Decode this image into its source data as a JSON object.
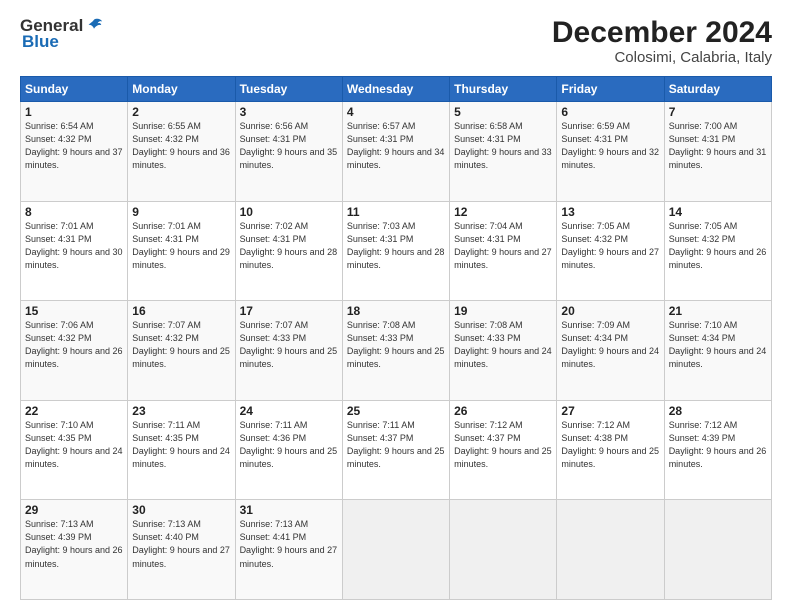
{
  "logo": {
    "general": "General",
    "blue": "Blue"
  },
  "header": {
    "month": "December 2024",
    "location": "Colosimi, Calabria, Italy"
  },
  "weekdays": [
    "Sunday",
    "Monday",
    "Tuesday",
    "Wednesday",
    "Thursday",
    "Friday",
    "Saturday"
  ],
  "weeks": [
    [
      {
        "day": "1",
        "sunrise": "Sunrise: 6:54 AM",
        "sunset": "Sunset: 4:32 PM",
        "daylight": "Daylight: 9 hours and 37 minutes."
      },
      {
        "day": "2",
        "sunrise": "Sunrise: 6:55 AM",
        "sunset": "Sunset: 4:32 PM",
        "daylight": "Daylight: 9 hours and 36 minutes."
      },
      {
        "day": "3",
        "sunrise": "Sunrise: 6:56 AM",
        "sunset": "Sunset: 4:31 PM",
        "daylight": "Daylight: 9 hours and 35 minutes."
      },
      {
        "day": "4",
        "sunrise": "Sunrise: 6:57 AM",
        "sunset": "Sunset: 4:31 PM",
        "daylight": "Daylight: 9 hours and 34 minutes."
      },
      {
        "day": "5",
        "sunrise": "Sunrise: 6:58 AM",
        "sunset": "Sunset: 4:31 PM",
        "daylight": "Daylight: 9 hours and 33 minutes."
      },
      {
        "day": "6",
        "sunrise": "Sunrise: 6:59 AM",
        "sunset": "Sunset: 4:31 PM",
        "daylight": "Daylight: 9 hours and 32 minutes."
      },
      {
        "day": "7",
        "sunrise": "Sunrise: 7:00 AM",
        "sunset": "Sunset: 4:31 PM",
        "daylight": "Daylight: 9 hours and 31 minutes."
      }
    ],
    [
      {
        "day": "8",
        "sunrise": "Sunrise: 7:01 AM",
        "sunset": "Sunset: 4:31 PM",
        "daylight": "Daylight: 9 hours and 30 minutes."
      },
      {
        "day": "9",
        "sunrise": "Sunrise: 7:01 AM",
        "sunset": "Sunset: 4:31 PM",
        "daylight": "Daylight: 9 hours and 29 minutes."
      },
      {
        "day": "10",
        "sunrise": "Sunrise: 7:02 AM",
        "sunset": "Sunset: 4:31 PM",
        "daylight": "Daylight: 9 hours and 28 minutes."
      },
      {
        "day": "11",
        "sunrise": "Sunrise: 7:03 AM",
        "sunset": "Sunset: 4:31 PM",
        "daylight": "Daylight: 9 hours and 28 minutes."
      },
      {
        "day": "12",
        "sunrise": "Sunrise: 7:04 AM",
        "sunset": "Sunset: 4:31 PM",
        "daylight": "Daylight: 9 hours and 27 minutes."
      },
      {
        "day": "13",
        "sunrise": "Sunrise: 7:05 AM",
        "sunset": "Sunset: 4:32 PM",
        "daylight": "Daylight: 9 hours and 27 minutes."
      },
      {
        "day": "14",
        "sunrise": "Sunrise: 7:05 AM",
        "sunset": "Sunset: 4:32 PM",
        "daylight": "Daylight: 9 hours and 26 minutes."
      }
    ],
    [
      {
        "day": "15",
        "sunrise": "Sunrise: 7:06 AM",
        "sunset": "Sunset: 4:32 PM",
        "daylight": "Daylight: 9 hours and 26 minutes."
      },
      {
        "day": "16",
        "sunrise": "Sunrise: 7:07 AM",
        "sunset": "Sunset: 4:32 PM",
        "daylight": "Daylight: 9 hours and 25 minutes."
      },
      {
        "day": "17",
        "sunrise": "Sunrise: 7:07 AM",
        "sunset": "Sunset: 4:33 PM",
        "daylight": "Daylight: 9 hours and 25 minutes."
      },
      {
        "day": "18",
        "sunrise": "Sunrise: 7:08 AM",
        "sunset": "Sunset: 4:33 PM",
        "daylight": "Daylight: 9 hours and 25 minutes."
      },
      {
        "day": "19",
        "sunrise": "Sunrise: 7:08 AM",
        "sunset": "Sunset: 4:33 PM",
        "daylight": "Daylight: 9 hours and 24 minutes."
      },
      {
        "day": "20",
        "sunrise": "Sunrise: 7:09 AM",
        "sunset": "Sunset: 4:34 PM",
        "daylight": "Daylight: 9 hours and 24 minutes."
      },
      {
        "day": "21",
        "sunrise": "Sunrise: 7:10 AM",
        "sunset": "Sunset: 4:34 PM",
        "daylight": "Daylight: 9 hours and 24 minutes."
      }
    ],
    [
      {
        "day": "22",
        "sunrise": "Sunrise: 7:10 AM",
        "sunset": "Sunset: 4:35 PM",
        "daylight": "Daylight: 9 hours and 24 minutes."
      },
      {
        "day": "23",
        "sunrise": "Sunrise: 7:11 AM",
        "sunset": "Sunset: 4:35 PM",
        "daylight": "Daylight: 9 hours and 24 minutes."
      },
      {
        "day": "24",
        "sunrise": "Sunrise: 7:11 AM",
        "sunset": "Sunset: 4:36 PM",
        "daylight": "Daylight: 9 hours and 25 minutes."
      },
      {
        "day": "25",
        "sunrise": "Sunrise: 7:11 AM",
        "sunset": "Sunset: 4:37 PM",
        "daylight": "Daylight: 9 hours and 25 minutes."
      },
      {
        "day": "26",
        "sunrise": "Sunrise: 7:12 AM",
        "sunset": "Sunset: 4:37 PM",
        "daylight": "Daylight: 9 hours and 25 minutes."
      },
      {
        "day": "27",
        "sunrise": "Sunrise: 7:12 AM",
        "sunset": "Sunset: 4:38 PM",
        "daylight": "Daylight: 9 hours and 25 minutes."
      },
      {
        "day": "28",
        "sunrise": "Sunrise: 7:12 AM",
        "sunset": "Sunset: 4:39 PM",
        "daylight": "Daylight: 9 hours and 26 minutes."
      }
    ],
    [
      {
        "day": "29",
        "sunrise": "Sunrise: 7:13 AM",
        "sunset": "Sunset: 4:39 PM",
        "daylight": "Daylight: 9 hours and 26 minutes."
      },
      {
        "day": "30",
        "sunrise": "Sunrise: 7:13 AM",
        "sunset": "Sunset: 4:40 PM",
        "daylight": "Daylight: 9 hours and 27 minutes."
      },
      {
        "day": "31",
        "sunrise": "Sunrise: 7:13 AM",
        "sunset": "Sunset: 4:41 PM",
        "daylight": "Daylight: 9 hours and 27 minutes."
      },
      null,
      null,
      null,
      null
    ]
  ]
}
